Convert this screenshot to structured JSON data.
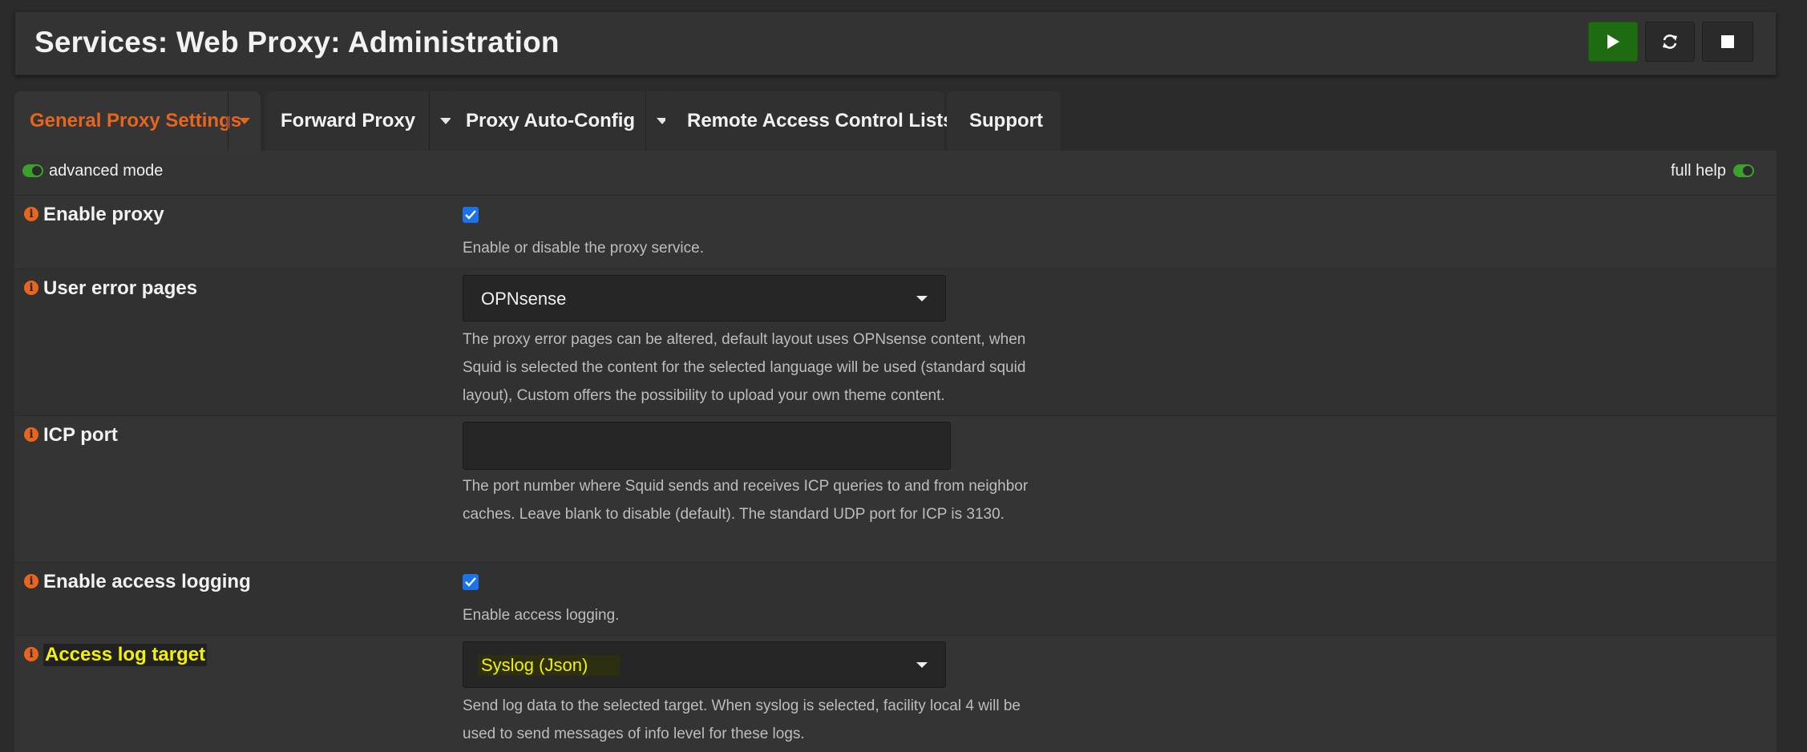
{
  "header": {
    "title": "Services: Web Proxy: Administration",
    "buttons": {
      "start_icon": "play-icon",
      "restart_icon": "refresh-icon",
      "stop_icon": "stop-icon",
      "start_color": "#1f6b12"
    }
  },
  "tabs": [
    {
      "label": "General Proxy Settings",
      "active": true,
      "has_dropdown": true
    },
    {
      "label": "Forward Proxy",
      "active": false,
      "has_dropdown": true
    },
    {
      "label": "Proxy Auto-Config",
      "active": false,
      "has_dropdown": true
    },
    {
      "label": "Remote Access Control Lists",
      "active": false,
      "has_dropdown": false
    },
    {
      "label": "Support",
      "active": false,
      "has_dropdown": false
    }
  ],
  "mode_bar": {
    "advanced_mode_label": "advanced mode",
    "advanced_mode_on": true,
    "full_help_label": "full help",
    "full_help_on": true
  },
  "fields": {
    "enable_proxy": {
      "label": "Enable proxy",
      "checked": true,
      "help": "Enable or disable the proxy service."
    },
    "user_error_pages": {
      "label": "User error pages",
      "value": "OPNsense",
      "help": "The proxy error pages can be altered, default layout uses OPNsense content, when Squid is selected the content for the selected language will be used (standard squid layout), Custom offers the possibility to upload your own theme content."
    },
    "icp_port": {
      "label": "ICP port",
      "value": "",
      "help": "The port number where Squid sends and receives ICP queries to and from neighbor caches. Leave blank to disable (default). The standard UDP port for ICP is 3130."
    },
    "enable_access_logging": {
      "label": "Enable access logging",
      "checked": true,
      "help": "Enable access logging."
    },
    "access_log_target": {
      "label": "Access log target",
      "value": "Syslog (Json)",
      "help": "Send log data to the selected target. When syslog is selected, facility local 4 will be used to send messages of info level for these logs."
    }
  },
  "colors": {
    "accent": "#e8651d",
    "toggle_on": "#3aa12b",
    "checkbox": "#1a73e8",
    "highlight_text": "#f3f300"
  }
}
